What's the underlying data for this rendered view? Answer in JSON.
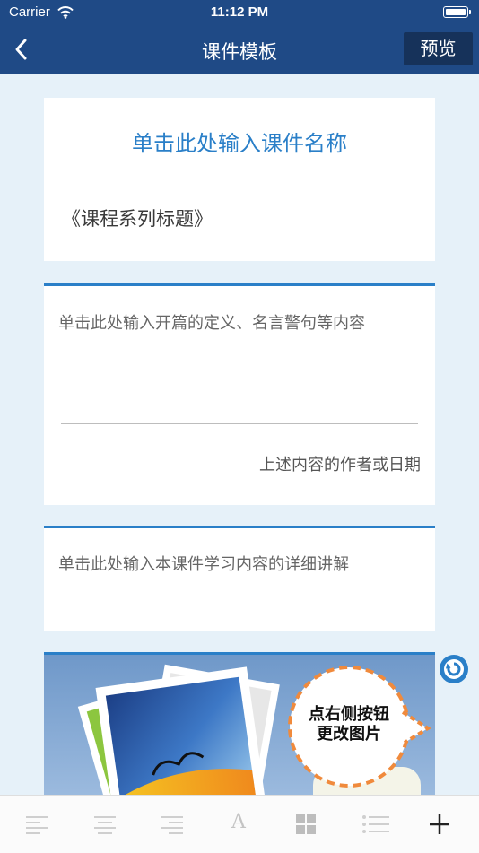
{
  "status": {
    "carrier": "Carrier",
    "time": "11:12 PM"
  },
  "nav": {
    "title": "课件模板",
    "preview_label": "预览"
  },
  "card1": {
    "name_placeholder": "单击此处输入课件名称",
    "series_title": "《课程系列标题》"
  },
  "card2": {
    "quote_placeholder": "单击此处输入开篇的定义、名言警句等内容",
    "author_placeholder": "上述内容的作者或日期"
  },
  "card3": {
    "content_placeholder": "单击此处输入本课件学习内容的详细讲解"
  },
  "card4": {
    "image_hint_line1": "点右侧按钮",
    "image_hint_line2": "更改图片"
  },
  "toolbar": {
    "tools": [
      "align-left-icon",
      "align-center-icon",
      "align-right-icon",
      "font-icon",
      "grid-icon",
      "list-icon",
      "add-icon"
    ]
  },
  "colors": {
    "nav": "#1f4a86",
    "accent": "#2a7fc8",
    "background": "#e6f1f9"
  }
}
